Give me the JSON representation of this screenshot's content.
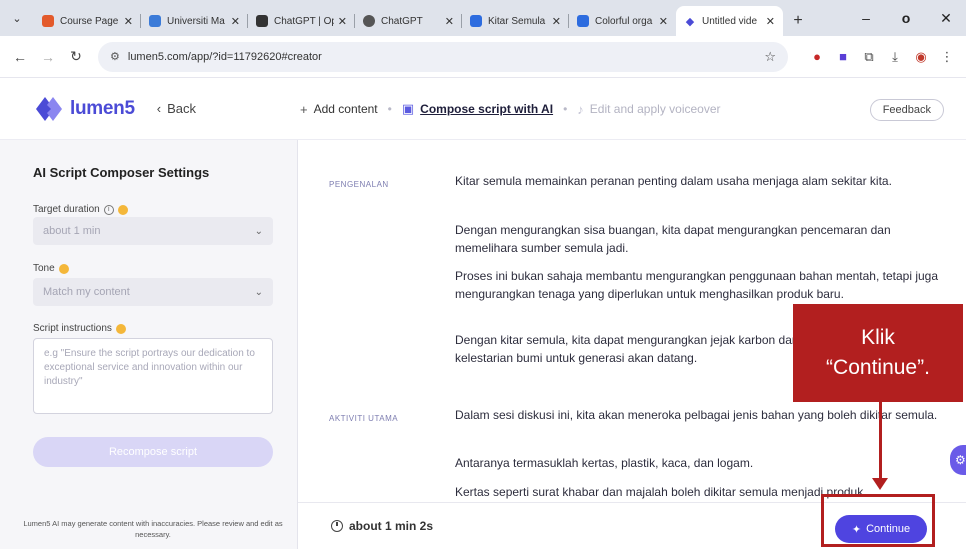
{
  "browser": {
    "menu_icon": "chevron-down",
    "tabs": [
      {
        "label": "Course Page |",
        "favicon_color": "#e35a2b"
      },
      {
        "label": "Universiti Ma",
        "favicon_color": "#3b7bd8"
      },
      {
        "label": "ChatGPT | Op",
        "favicon_color": "#333333"
      },
      {
        "label": "ChatGPT",
        "favicon_color": "#555555"
      },
      {
        "label": "Kitar Semula",
        "favicon_color": "#2d6cdf"
      },
      {
        "label": "Colorful orga",
        "favicon_color": "#2d6cdf"
      },
      {
        "label": "Untitled vide",
        "favicon_color": "#4b4bd6"
      }
    ],
    "new_tab": "+",
    "minimize": "–",
    "restore": "o",
    "close": "✕",
    "url": "lumen5.com/app/?id=11792620#creator"
  },
  "header": {
    "brand": "lumen5",
    "back_label": "Back",
    "steps": [
      {
        "icon": "plus-icon",
        "label": "Add content"
      },
      {
        "icon": "document-ai-icon",
        "label": "Compose script with AI"
      },
      {
        "icon": "microphone-icon",
        "label": "Edit and apply voiceover"
      }
    ],
    "feedback_label": "Feedback"
  },
  "sidebar": {
    "title": "AI Script Composer Settings",
    "target_duration_label": "Target duration",
    "target_duration_value": "about 1 min",
    "tone_label": "Tone",
    "tone_value": "Match my content",
    "script_instructions_label": "Script instructions",
    "script_instructions_placeholder": "e.g \"Ensure the script portrays our dedication to exceptional service and innovation within our industry\"",
    "recompose_label": "Recompose script",
    "disclaimer": "Lumen5 AI may generate content with inaccuracies. Please review and edit as necessary."
  },
  "script": {
    "sections": [
      {
        "label": "PENGENALAN",
        "paragraphs": [
          "Kitar semula memainkan peranan penting dalam usaha menjaga alam sekitar kita.",
          "Dengan mengurangkan sisa buangan, kita dapat mengurangkan pencemaran dan memelihara sumber semula jadi.",
          "Proses ini bukan sahaja membantu mengurangkan penggunaan bahan mentah, tetapi juga mengurangkan tenaga yang diperlukan untuk menghasilkan produk baru.",
          "Dengan kitar semula, kita dapat mengurangkan jejak karbon dan menyumbang kepada kelestarian bumi untuk generasi akan datang."
        ]
      },
      {
        "label": "AKTIVITI UTAMA",
        "paragraphs": [
          "Dalam sesi diskusi ini, kita akan meneroka pelbagai jenis bahan yang boleh dikitar semula.",
          "Antaranya termasuklah kertas, plastik, kaca, dan logam.",
          "Kertas seperti surat khabar dan majalah boleh dikitar semula menjadi produk"
        ]
      }
    ]
  },
  "footer": {
    "duration": "about 1 min 2s",
    "continue_label": "Continue"
  },
  "annotation": {
    "line1": "Klik",
    "line2": "“Continue”.",
    "color": "#b21f1f"
  },
  "colors": {
    "accent": "#4f44e0",
    "brand": "#4b4bd6"
  }
}
